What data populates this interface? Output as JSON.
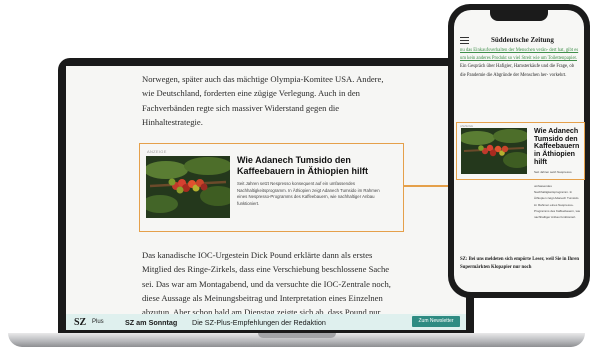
{
  "laptop": {
    "paragraph_top": "Norwegen, später auch das mächtige Olympia-Komitee USA. Andere, wie Deutschland, forderten eine zügige Verlegung. Auch in den Fachverbänden regte sich massiver Widerstand gegen die Hinhaltestrategie.",
    "teaser": {
      "kicker": "ANZEIGE",
      "title": "Wie Adanech Tumsido den Kaffeebauern in Äthiopien hilft",
      "description": "Seit Jahren setzt Nespresso konsequent auf ein umfassendes Nachhaltigkeitsprogramm. In Äthiopien zeigt Adanech Tumsido im Rahmen eines Nespresso-Programms des Kaffeebauern, wie nachhaltiger Anbau funktioniert."
    },
    "paragraph_bottom": "Das kanadische IOC-Urgestein Dick Pound erklärte dann als erstes Mitglied des Ringe-Zirkels, dass eine Verschiebung beschlossene Sache sei. Das war am Montagabend, und da versuchte die IOC-Zentrale noch, diese Aussage als Meinungsbeitrag und Interpretation eines Einzelnen abzutun. Aber schon bald am Dienstag zeigte sich ab, dass Pound nur",
    "promo": {
      "logo": "SZ",
      "logo_plus": "Plus",
      "title": "SZ am Sonntag",
      "text": "Die SZ-Plus-Empfehlungen der Redaktion",
      "button": "Zum Newsletter"
    }
  },
  "phone": {
    "brand": "Süddeutsche Zeitung",
    "link_text": "nu das Einkaufsverhalten der Menschen verän- dert hat, gibt es um kein anderes Produkt so viel Streit wie um Toilettenpapier.",
    "paragraph_top": "Ein Gespräch über Hafigier, Hamsterkäufe und die Frage, ob die Pandemie die Abgründe der Menschen her- vorkehrt.",
    "teaser": {
      "kicker": "ANZEIGE",
      "title": "Wie Adanech Tumsido den Kaffeebauern in Äthiopien hilft",
      "description": "Seit Jahren setzt Nespresso"
    },
    "sidebar_text": "umfassendes Nachhaltigkeitsprogramm. In Äthiopien zeigt Adanech Tumsido im Rahmen eines Nespresso-Programms des Kaffeebauern, wie nachhaltiger Anbau funktioniert.",
    "bottom_text": "SZ: Bei uns meldeten sich empörte Leser, weil Sie in Ihren Supermärkten Klopapier nur noch"
  },
  "colors": {
    "highlight": "#e5a04a",
    "promo_bg": "#dff0ee",
    "promo_button": "#2e8b82",
    "link": "#3f8f4a"
  }
}
